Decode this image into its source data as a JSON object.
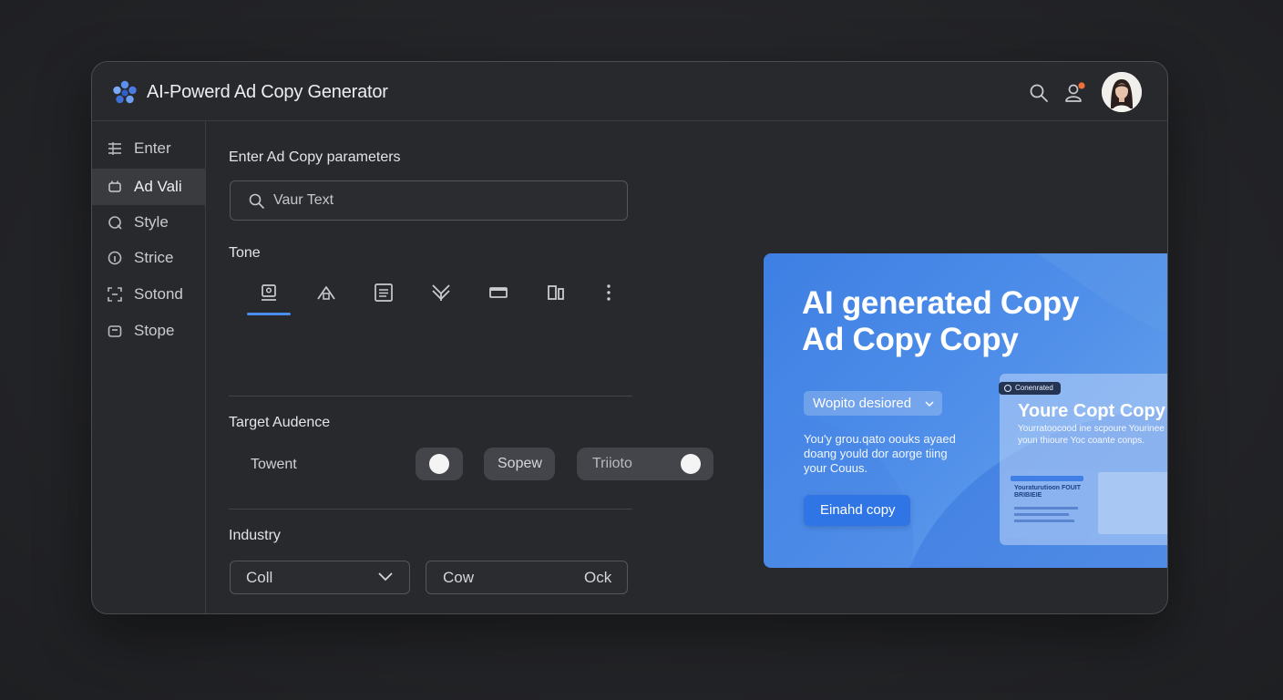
{
  "app": {
    "title": "AI-Powerd Ad Copy Generator"
  },
  "sidebar": {
    "items": [
      {
        "label": "Enter",
        "icon": "list-icon"
      },
      {
        "label": "Ad Vali",
        "icon": "ad-icon"
      },
      {
        "label": "Style",
        "icon": "style-icon"
      },
      {
        "label": "Strice",
        "icon": "info-icon"
      },
      {
        "label": "Sotond",
        "icon": "frame-icon"
      },
      {
        "label": "Stope",
        "icon": "box-icon"
      }
    ],
    "active_index": 1
  },
  "form": {
    "heading": "Enter Ad Copy parameters",
    "search_value": "Vaur Text",
    "tone_label": "Tone",
    "tone_icons": [
      "image-icon",
      "home-icon",
      "document-icon",
      "grid-icon",
      "card-icon",
      "columns-icon",
      "more-icon"
    ],
    "audience_label": "Target Audence",
    "audience_options": [
      {
        "label": "Towent"
      },
      {
        "label": "Sopew"
      },
      {
        "label": "Triioto"
      }
    ],
    "industry_label": "Industry",
    "industry_select": "Coll",
    "industry_second_left": "Cow",
    "industry_second_right": "Ock"
  },
  "preview": {
    "title_line1": "AI generated Copy",
    "title_line2": "Ad Copy Copy",
    "dropdown": "Wopito desiored",
    "body": "You'y grou.qato oouks ayaed doang yould dor aorge tiing your Couus.",
    "button": "Einahd copy",
    "card_badge": "Conenrated",
    "card_title": "Youre Copt Copy",
    "card_sub": "Yourratoocood ine scpoure Yourinee youn thioure Yoc coante conps.",
    "lower_heading": "Youraturutioon FOUIT BRIBIEIE"
  },
  "colors": {
    "accent": "#4a8ef0",
    "preview_gradient_start": "#3d7fe3",
    "preview_gradient_end": "#6ea9ef",
    "notification_dot": "#f0703a"
  }
}
